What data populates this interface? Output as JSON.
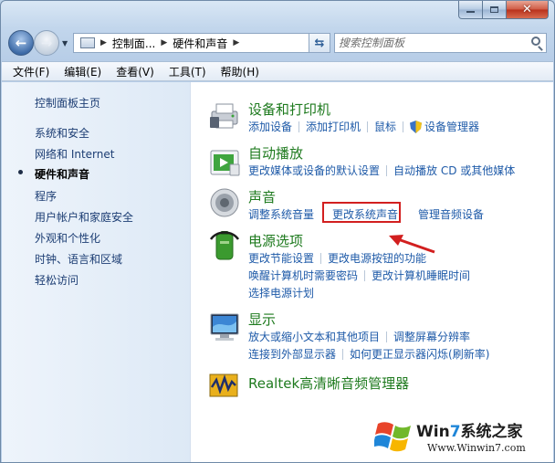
{
  "address": {
    "crumbs": [
      "控制面...",
      "硬件和声音"
    ],
    "search_placeholder": "搜索控制面板"
  },
  "menu": [
    "文件(F)",
    "编辑(E)",
    "查看(V)",
    "工具(T)",
    "帮助(H)"
  ],
  "sidebar": {
    "items": [
      {
        "label": "控制面板主页",
        "active": false
      },
      {
        "label": "系统和安全",
        "active": false
      },
      {
        "label": "网络和 Internet",
        "active": false
      },
      {
        "label": "硬件和声音",
        "active": true
      },
      {
        "label": "程序",
        "active": false
      },
      {
        "label": "用户帐户和家庭安全",
        "active": false
      },
      {
        "label": "外观和个性化",
        "active": false
      },
      {
        "label": "时钟、语言和区域",
        "active": false
      },
      {
        "label": "轻松访问",
        "active": false
      }
    ]
  },
  "categories": {
    "devices": {
      "icon": "printer-icon",
      "title": "设备和打印机",
      "links": [
        "添加设备",
        "添加打印机",
        "鼠标",
        "设备管理器"
      ]
    },
    "autoplay": {
      "icon": "autoplay-icon",
      "title": "自动播放",
      "links": [
        "更改媒体或设备的默认设置",
        "自动播放 CD 或其他媒体"
      ]
    },
    "sound": {
      "icon": "speaker-icon",
      "title": "声音",
      "links": [
        "调整系统音量",
        "更改系统声音",
        "管理音频设备"
      ]
    },
    "power": {
      "icon": "battery-icon",
      "title": "电源选项",
      "links_row1": [
        "更改节能设置",
        "更改电源按钮的功能"
      ],
      "links_row2": [
        "唤醒计算机时需要密码",
        "更改计算机睡眠时间"
      ],
      "links_row3": [
        "选择电源计划"
      ]
    },
    "display": {
      "icon": "monitor-icon",
      "title": "显示",
      "links_row1": [
        "放大或缩小文本和其他项目",
        "调整屏幕分辨率"
      ],
      "links_row2": [
        "连接到外部显示器",
        "如何更正显示器闪烁(刷新率)"
      ]
    },
    "realtek": {
      "icon": "realtek-icon",
      "title": "Realtek高清晰音频管理器"
    }
  },
  "watermark": {
    "brand_prefix": "Win",
    "brand_seven": "7",
    "brand_suffix": "系统之家",
    "url": "Www.Winwin7.com"
  },
  "colors": {
    "link": "#1e5aa8",
    "category_title": "#1e7a1e",
    "highlight": "#d21f1f"
  }
}
